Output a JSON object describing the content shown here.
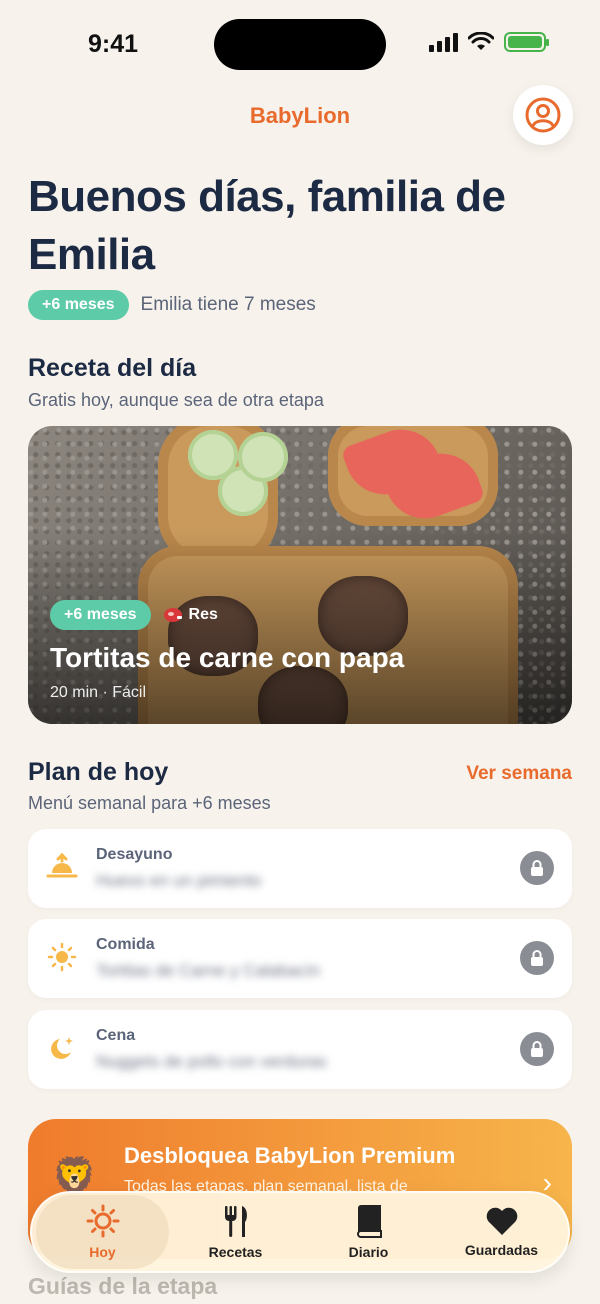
{
  "status_bar": {
    "time": "9:41"
  },
  "header": {
    "brand": "BabyLion"
  },
  "greeting": {
    "title": "Buenos días, familia de Emilia",
    "stage_pill": "+6 meses",
    "age_text": "Emilia tiene 7 meses"
  },
  "recipe_section": {
    "title": "Receta del día",
    "subtitle": "Gratis hoy, aunque sea de otra etapa",
    "card": {
      "stage_pill": "+6 meses",
      "protein": "Res",
      "title": "Tortitas de carne con papa",
      "meta": "20 min · Fácil"
    }
  },
  "plan_section": {
    "title": "Plan de hoy",
    "link": "Ver semana",
    "subtitle": "Menú semanal para +6 meses",
    "meals": [
      {
        "name": "Desayuno",
        "icon": "sunrise-icon",
        "dish": "Huevo en un pimiento"
      },
      {
        "name": "Comida",
        "icon": "sun-icon",
        "dish": "Tortitas de Carne y Calabacín"
      },
      {
        "name": "Cena",
        "icon": "moon-icon",
        "dish": "Nuggets de pollo con verduras"
      }
    ]
  },
  "premium": {
    "title": "Desbloquea BabyLion Premium",
    "subtitle": "Todas las etapas, plan semanal, lista de"
  },
  "next_section": {
    "title": "Guías de la etapa"
  },
  "tabbar": {
    "tabs": [
      {
        "label": "Hoy",
        "icon": "sun-icon",
        "active": true
      },
      {
        "label": "Recetas",
        "icon": "fork-knife-icon"
      },
      {
        "label": "Diario",
        "icon": "book-icon"
      },
      {
        "label": "Guardadas",
        "icon": "heart-icon"
      }
    ]
  },
  "colors": {
    "accent": "#e86a2c",
    "stage_green": "#5dcba7",
    "title_navy": "#1d2a44",
    "background": "#f7f3ec"
  }
}
